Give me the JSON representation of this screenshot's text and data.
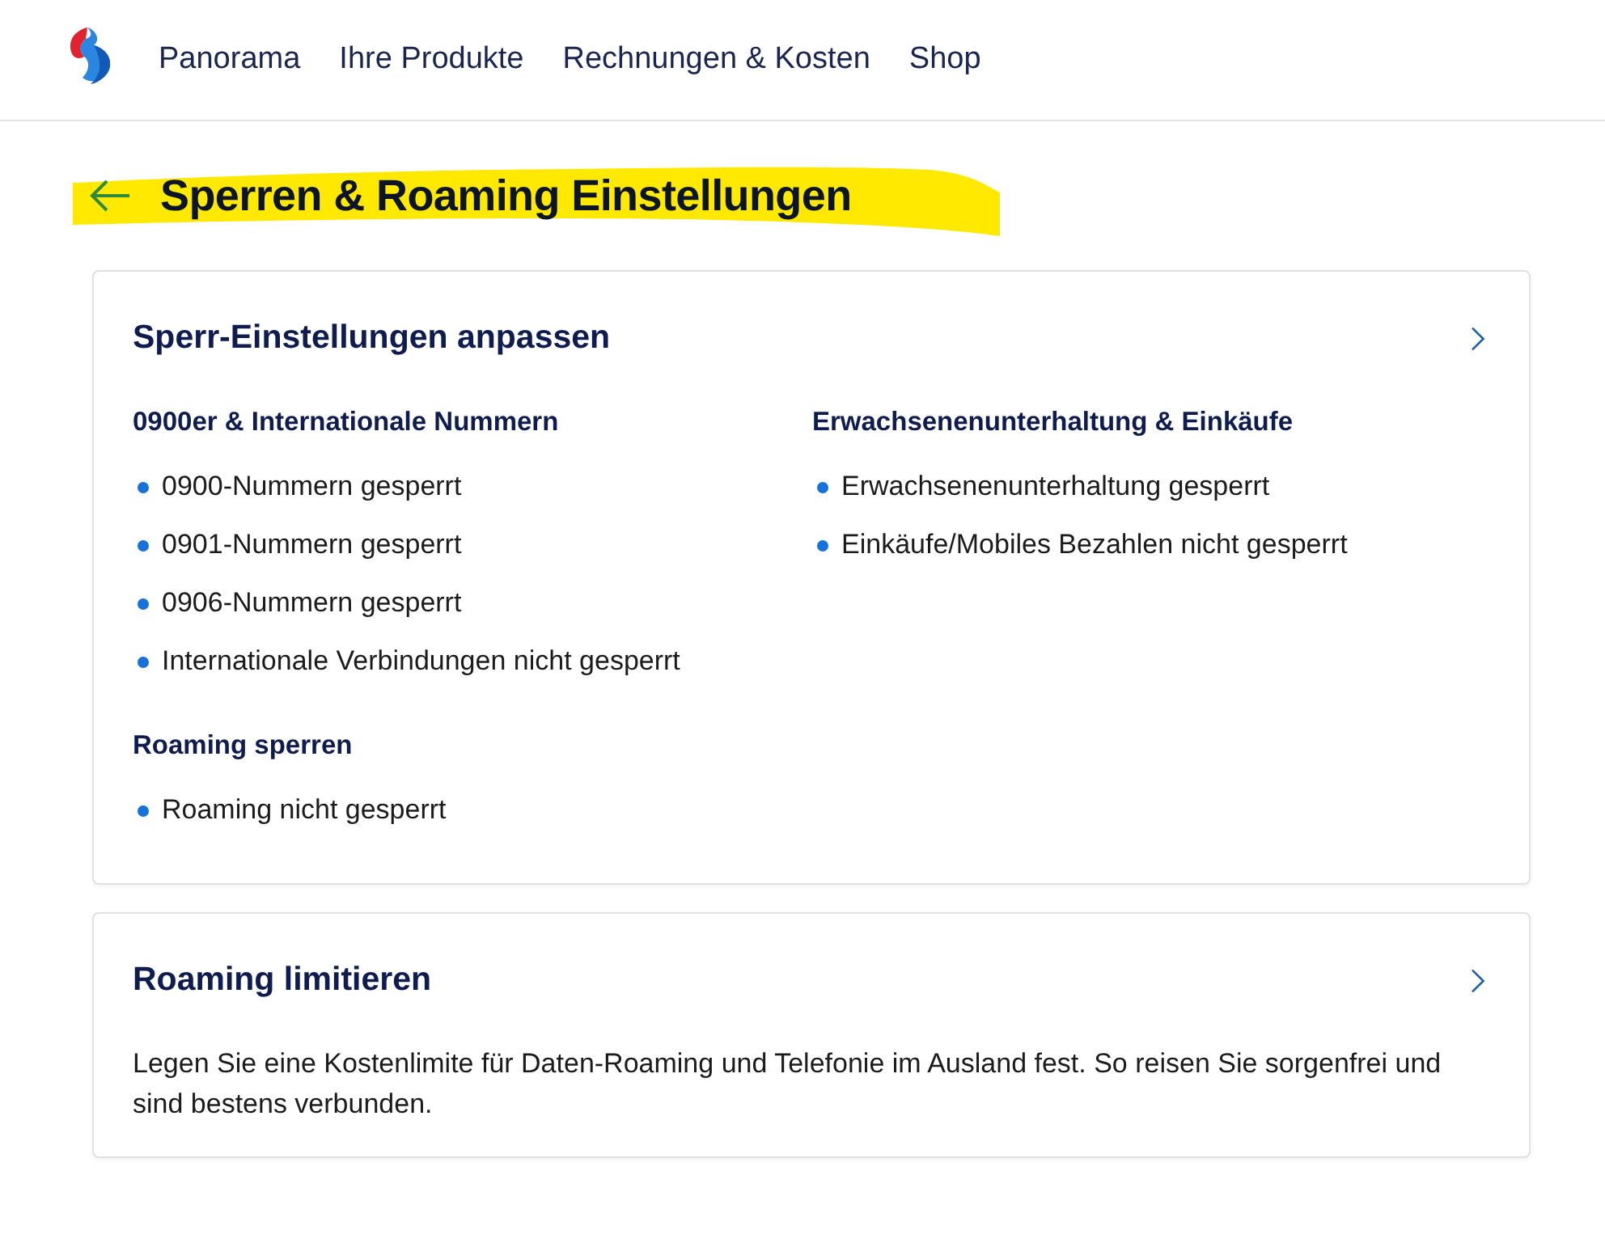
{
  "nav": {
    "items": [
      {
        "label": "Panorama"
      },
      {
        "label": "Ihre Produkte"
      },
      {
        "label": "Rechnungen & Kosten"
      },
      {
        "label": "Shop"
      }
    ]
  },
  "page": {
    "title": "Sperren & Roaming Einstellungen",
    "highlighted": true
  },
  "cards": [
    {
      "kind": "groups",
      "title": "Sperr-Einstellungen anpassen",
      "groups": [
        {
          "heading": "0900er & Internationale Nummern",
          "items": [
            "0900-Nummern gesperrt",
            "0901-Nummern gesperrt",
            "0906-Nummern gesperrt",
            "Internationale Verbindungen nicht gesperrt"
          ]
        },
        {
          "heading": "Erwachsenenunterhaltung & Einkäufe",
          "items": [
            "Erwachsenenunterhaltung gesperrt",
            "Einkäufe/Mobiles Bezahlen nicht gesperrt"
          ]
        },
        {
          "heading": "Roaming sperren",
          "items": [
            "Roaming nicht gesperrt"
          ]
        }
      ]
    },
    {
      "kind": "text",
      "title": "Roaming limitieren",
      "text": "Legen Sie eine Kostenlimite für Daten-Roaming und Telefonie im Ausland fest. So reisen Sie sorgenfrei und sind bestens verbunden."
    }
  ]
}
